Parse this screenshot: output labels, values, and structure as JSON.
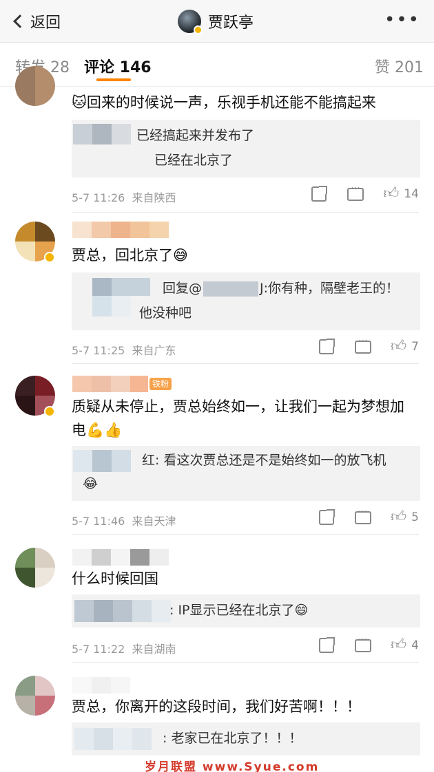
{
  "header": {
    "back_label": "返回",
    "user_name": "贾跃亭"
  },
  "tabs": [
    {
      "label": "转发 28"
    },
    {
      "label": "评论 146"
    },
    {
      "label": "赞 201"
    }
  ],
  "comments": [
    {
      "text": "回来的时候说一声，乐视手机还能不能搞起来",
      "emoji_lead": "🐱",
      "replies": [
        "已经搞起来并发布了",
        "已经在北京了"
      ],
      "time": "5-7 11:26",
      "location": "来自陕西",
      "likes": "14"
    },
    {
      "text": "贾总，回北京了😅",
      "reply_line1": "回复@",
      "reply_line1b": "J:你有种，隔壁老王的！",
      "reply_line2": "他没种吧",
      "time": "5-7 11:25",
      "location": "来自广东",
      "likes": "7"
    },
    {
      "text": "质疑从未停止，贾总始终如一，让我们一起为梦想加电💪👍",
      "badge": "铁粉",
      "reply_line1": "红: 看这次贾总还是不是始终如一的放飞机",
      "reply_line2": "😂",
      "time": "5-7 11:46",
      "location": "来自天津",
      "likes": "5"
    },
    {
      "text": "什么时候回国",
      "reply_line1": ": IP显示已经在北京了😄",
      "time": "5-7 11:22",
      "location": "来自湖南",
      "likes": "4"
    },
    {
      "text": "贾总，你离开的这段时间，我们好苦啊！！！",
      "reply_line1": ": 老家已在北京了！！！"
    }
  ],
  "watermark": "岁月联盟 www.Syue.com"
}
